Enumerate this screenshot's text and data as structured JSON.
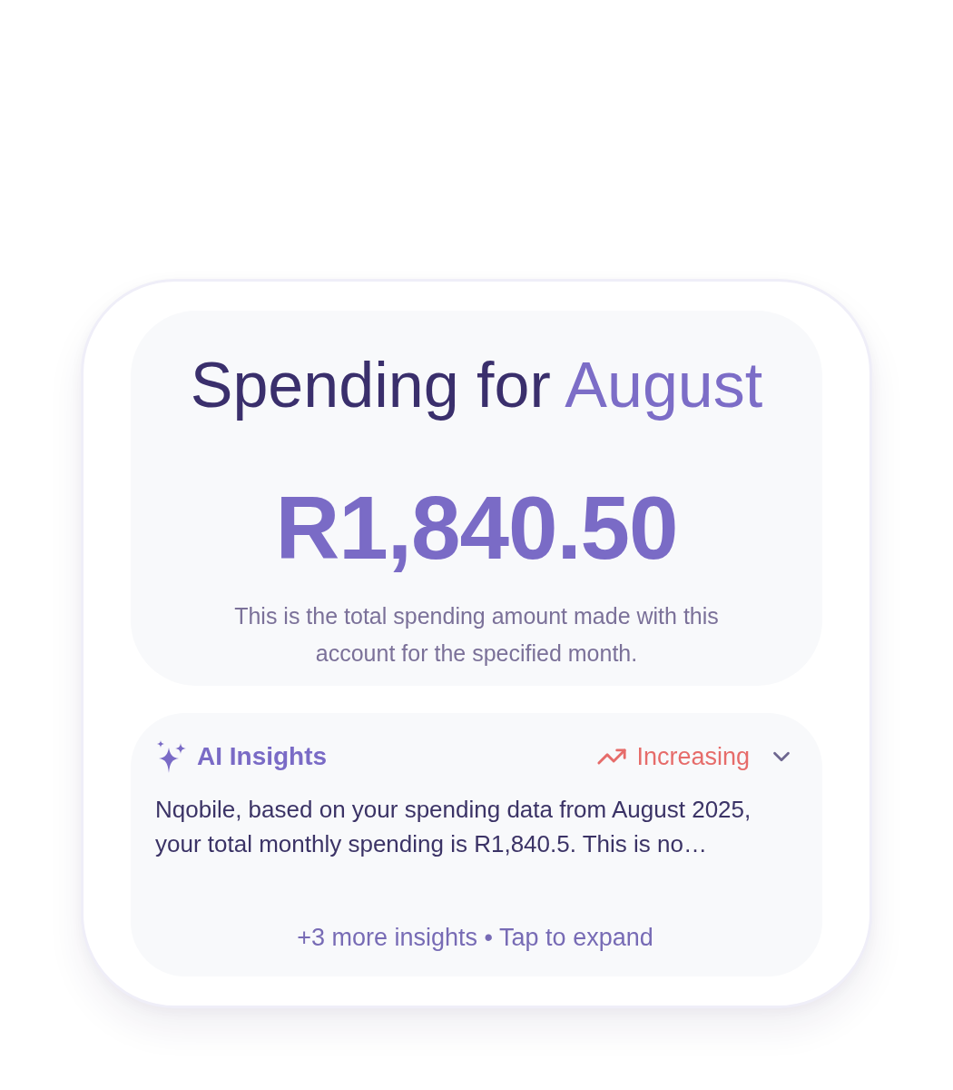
{
  "summary": {
    "title": "Spending for",
    "month": "August",
    "amount": "R1,840.50",
    "description": "This is the total spending amount made with this account for the specified month."
  },
  "insights": {
    "heading": "AI Insights",
    "trend": {
      "kind": "up",
      "label": "Increasing"
    },
    "expanded": false,
    "text": "Nqobile, based on your spending data from August 2025, your total monthly spending is R1,840.5. This is no…",
    "more": "+3 more insights • Tap to expand"
  }
}
